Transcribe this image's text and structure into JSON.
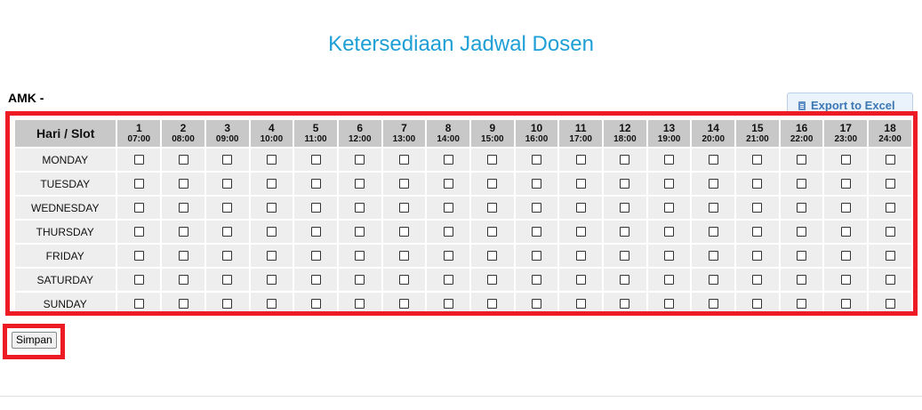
{
  "page": {
    "title": "Ketersediaan Jadwal Dosen"
  },
  "entity": {
    "label": "AMK -"
  },
  "toolbar": {
    "export_label": "Export to Excel",
    "export_icon": "excel-file-icon"
  },
  "schedule": {
    "corner_label": "Hari / Slot",
    "slots": [
      {
        "num": "1",
        "time": "07:00"
      },
      {
        "num": "2",
        "time": "08:00"
      },
      {
        "num": "3",
        "time": "09:00"
      },
      {
        "num": "4",
        "time": "10:00"
      },
      {
        "num": "5",
        "time": "11:00"
      },
      {
        "num": "6",
        "time": "12:00"
      },
      {
        "num": "7",
        "time": "13:00"
      },
      {
        "num": "8",
        "time": "14:00"
      },
      {
        "num": "9",
        "time": "15:00"
      },
      {
        "num": "10",
        "time": "16:00"
      },
      {
        "num": "11",
        "time": "17:00"
      },
      {
        "num": "12",
        "time": "18:00"
      },
      {
        "num": "13",
        "time": "19:00"
      },
      {
        "num": "14",
        "time": "20:00"
      },
      {
        "num": "15",
        "time": "21:00"
      },
      {
        "num": "16",
        "time": "22:00"
      },
      {
        "num": "17",
        "time": "23:00"
      },
      {
        "num": "18",
        "time": "24:00"
      }
    ],
    "days": [
      "MONDAY",
      "TUESDAY",
      "WEDNESDAY",
      "THURSDAY",
      "FRIDAY",
      "SATURDAY",
      "SUNDAY"
    ],
    "checked": false
  },
  "actions": {
    "save_label": "Simpan"
  },
  "colors": {
    "title": "#1e9fd6",
    "highlight": "#ed1c24",
    "header_bg": "#c8c8c8",
    "row_bg": "#eeeeee"
  }
}
